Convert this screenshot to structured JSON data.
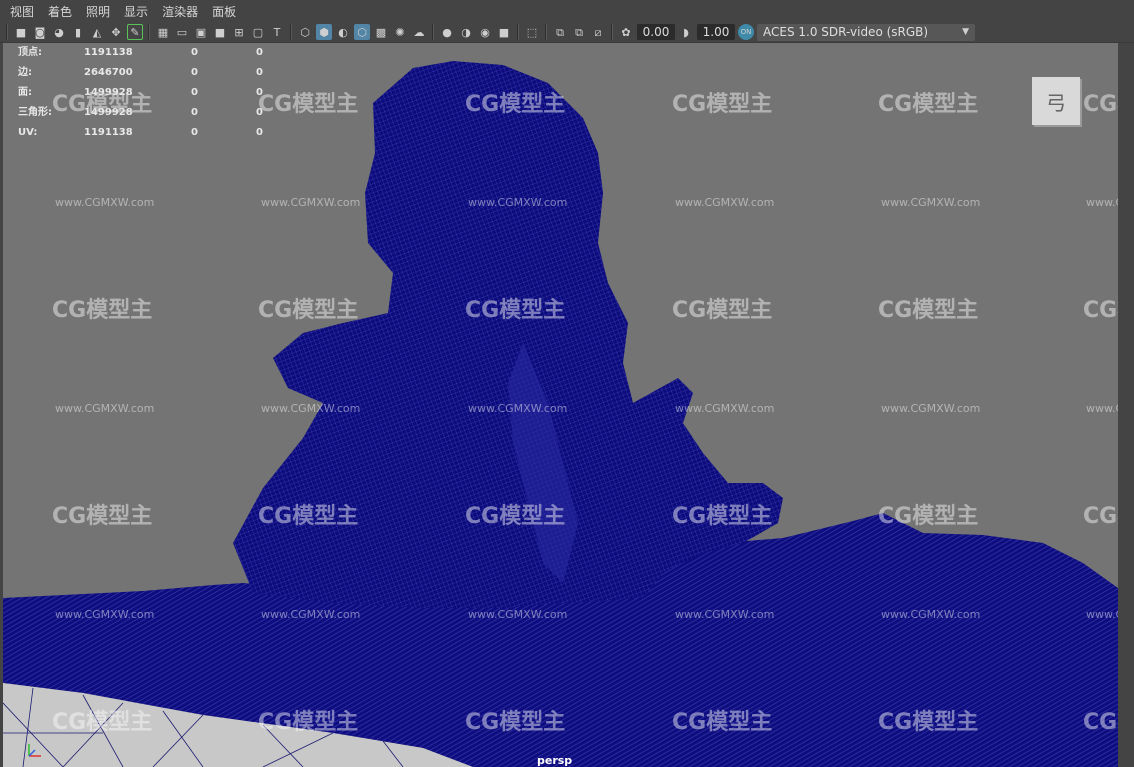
{
  "menu": {
    "items": [
      "视图",
      "着色",
      "照明",
      "显示",
      "渲染器",
      "面板"
    ]
  },
  "toolbar": {
    "exposure": "0.00",
    "gamma": "1.00",
    "color_space": "ACES 1.0 SDR-video (sRGB)"
  },
  "hud": {
    "rows": [
      {
        "label": "顶点:",
        "v1": "1191138",
        "v2": "0",
        "v3": "0"
      },
      {
        "label": "边:",
        "v1": "2646700",
        "v2": "0",
        "v3": "0"
      },
      {
        "label": "面:",
        "v1": "1499928",
        "v2": "0",
        "v3": "0"
      },
      {
        "label": "三角形:",
        "v1": "1499928",
        "v2": "0",
        "v3": "0"
      },
      {
        "label": "UV:",
        "v1": "1191138",
        "v2": "0",
        "v3": "0"
      }
    ]
  },
  "viewport": {
    "camera": "persp",
    "mesh_color": "#0b0b7a",
    "background_color": "#747474"
  },
  "watermark": {
    "brand": "CG模型主",
    "url": "www.CGMXW.com"
  },
  "view_cube": {
    "glyph": "弓"
  }
}
